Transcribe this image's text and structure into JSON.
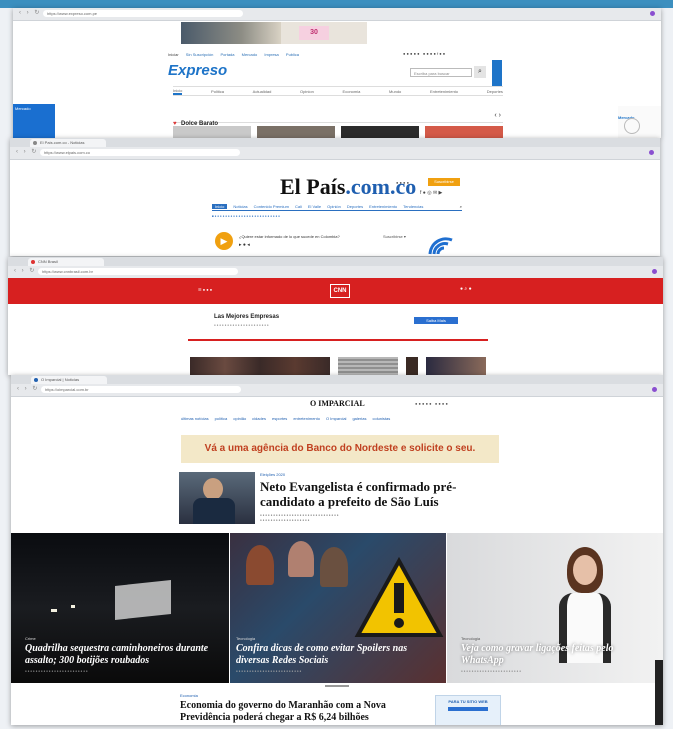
{
  "expreso": {
    "url": "https://www.expreso.com.pe",
    "logo": "Expreso",
    "nav": [
      "Inicio",
      "Politica",
      "Actualidad",
      "Opinion",
      "Economia",
      "Mundo",
      "Entretenimiento",
      "Deportes"
    ],
    "util_links": [
      "Iniciar",
      "Sin Suscripción",
      "Portada",
      "Mercado",
      "Impresa",
      "Publica"
    ],
    "search_placeholder": "Escriba para buscar",
    "section": "Dolce Barato",
    "ad_right": "Mercado"
  },
  "elpais": {
    "tab": "El País.com.co - Noticias",
    "url": "https://www.elpais.com.co",
    "logo_main": "El País",
    "logo_suffix": ".com.co",
    "menu": [
      "Inicio",
      "Noticias",
      "Contenido Premium",
      "Cali",
      "El Valle",
      "Opinión",
      "Deportes",
      "Entretenimiento",
      "Tendencias"
    ],
    "audio_question": "¿Quiere estar informado de lo que sucede en Colombia?",
    "subscribe": "Suscribirse"
  },
  "cnn": {
    "tab": "CNN Brasil",
    "url": "https://www.cnnbrasil.com.br",
    "logo": "CNN",
    "ad_title": "Las Mejores Empresas",
    "ad_button": "Saiba Mais"
  },
  "imparcial": {
    "tab": "O Imparcial | Notícias",
    "url": "https://oimparcial.com.br",
    "logo": "O IMPARCIAL",
    "nav": [
      "últimas notícias",
      "política",
      "opinião",
      "cidades",
      "esportes",
      "entretenimento",
      "O Imparcial",
      "galerias",
      "colunistas"
    ],
    "banner": "Vá a uma agência do Banco do Nordeste e solicite o seu.",
    "kicker": "Eleições 2020",
    "headline": "Neto Evangelista é confirmado pré-candidato a prefeito de São Luís",
    "story1_tag": "Crime",
    "story1": "Quadrilha sequestra caminhoneiros durante assalto; 300 botijões roubados",
    "story2_tag": "Tecnologia",
    "story2": "Confira dicas de como evitar Spoilers nas diversas Redes Sociais",
    "story3_tag": "Tecnologia",
    "story3": "Veja como gravar ligações feitas pelo WhatsApp",
    "bottom_kicker": "Economia",
    "bottom_headline": "Economia do governo do Maranhão com a Nova Previdência poderá chegar a R$ 6,24 bilhões",
    "bottom_ad": "PARA TU SITIO WEB"
  },
  "colors": {
    "expreso_blue": "#1e74c8",
    "cnn_red": "#d72020",
    "elpais_orange": "#f0a010",
    "banner_yellow": "#f3e8c8"
  }
}
